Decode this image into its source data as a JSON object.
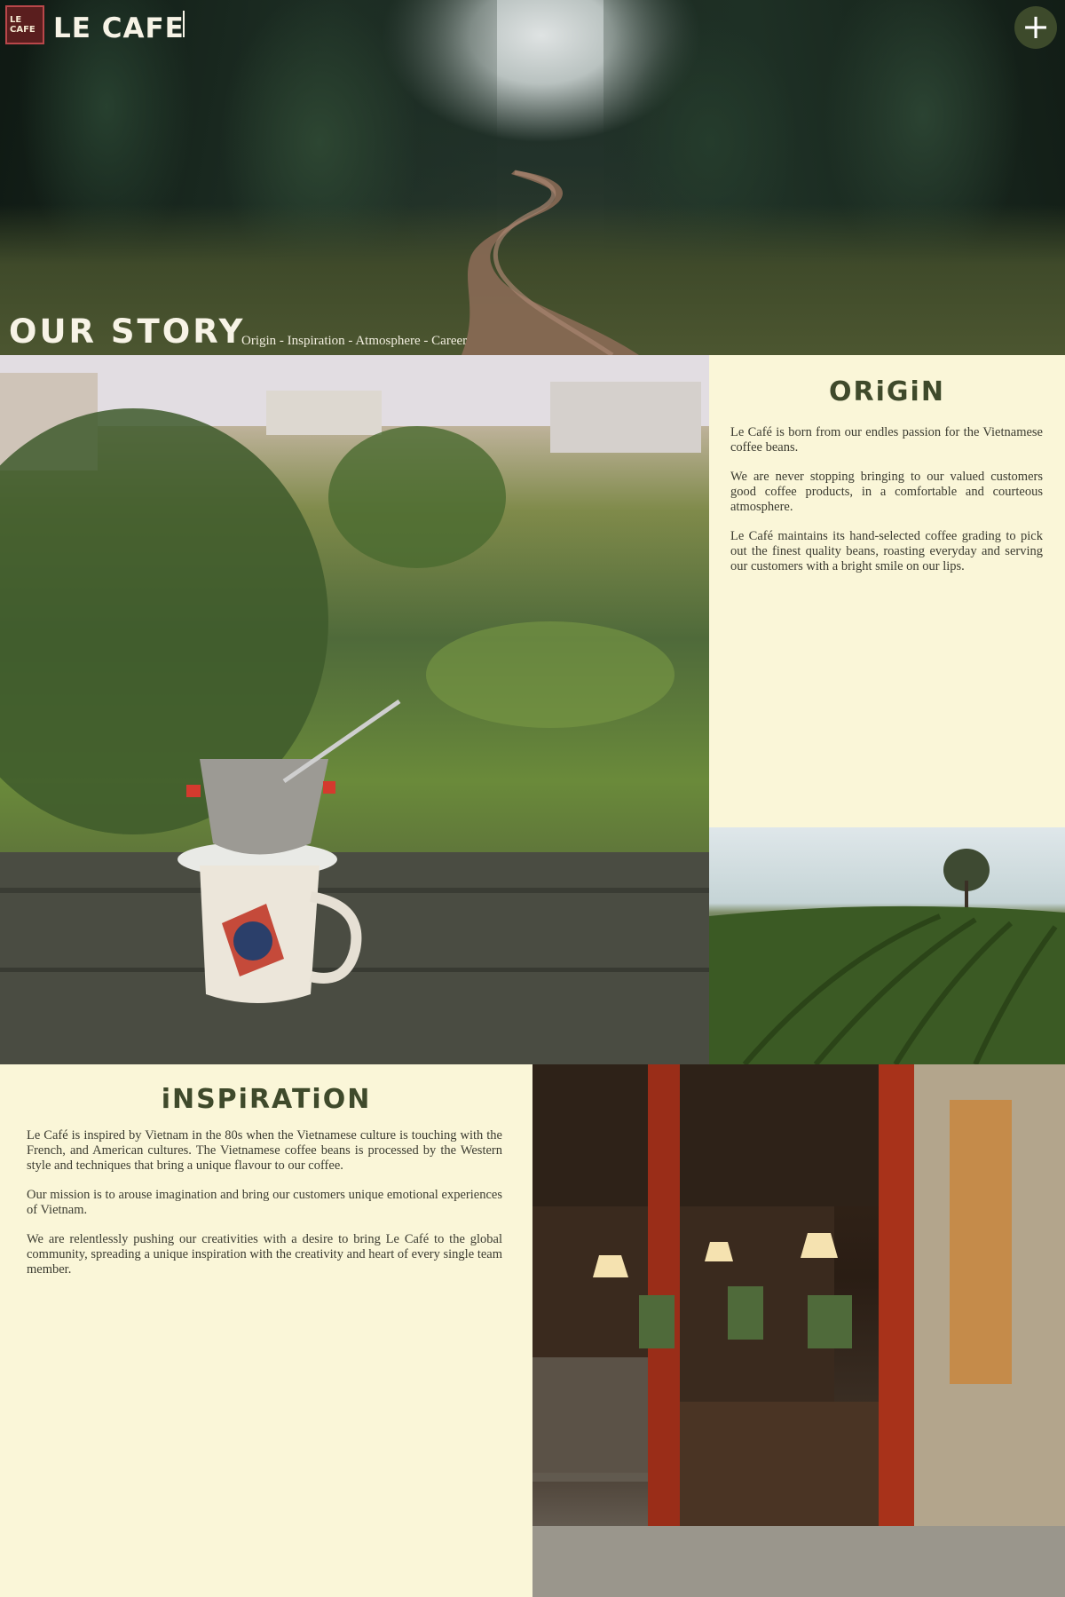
{
  "header": {
    "logo_mark_line1": "LE",
    "logo_mark_line2": "CAFE",
    "logo_text": "LE CAFE",
    "menu_button": "+"
  },
  "hero": {
    "title": "OUR STORY",
    "nav": [
      "Origin",
      "Inspiration",
      "Atmosphere",
      "Career"
    ],
    "nav_separator": " - "
  },
  "origin": {
    "heading": "ORiGiN",
    "paragraphs": [
      "Le Café is born from our endles passion for the Vietnamese coffee beans.",
      "We are never stopping bringing to our valued customers good coffee products, in a comfortable and courteous atmosphere.",
      "Le Café maintains its hand-selected coffee grading to pick out the finest quality beans, roasting everyday and serving our customers with a bright smile on our lips."
    ]
  },
  "inspiration": {
    "heading": "iNSPiRATiON",
    "paragraphs": [
      "Le Café is inspired by Vietnam in the 80s when the Vietnamese culture is touching with the French, and American cultures. The Vietnamese coffee beans is processed by the Western style and techniques that bring a unique flavour to our coffee.",
      "Our mission is to arouse imagination and bring our customers unique emotional experiences of Vietnam.",
      "We are relentlessly pushing our creativities with a desire to bring Le Café to the global community, spreading a unique inspiration with the creativity and heart of every single team member."
    ]
  },
  "colors": {
    "panel_bg": "#faf6d8",
    "heading_green": "#3f4a2b",
    "logo_red": "#5a1e1e",
    "menu_green": "#3d4a2b"
  }
}
